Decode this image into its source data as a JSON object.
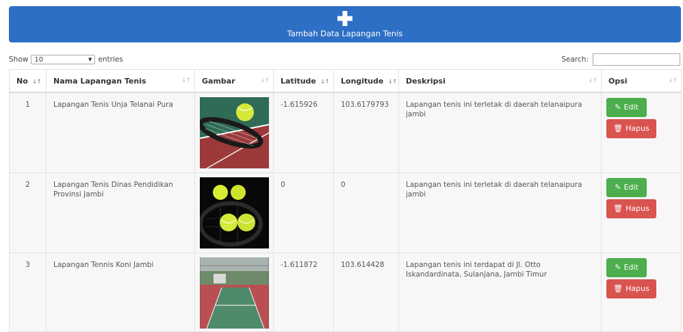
{
  "add_button": {
    "label": "Tambah Data Lapangan Tenis",
    "icon": "plus-icon"
  },
  "length_control": {
    "show_label": "Show",
    "value": "10",
    "entries_label": "entries"
  },
  "search": {
    "label": "Search:",
    "value": ""
  },
  "table": {
    "headers": [
      "No",
      "Nama Lapangan Tenis",
      "Gambar",
      "Latitude",
      "Longitude",
      "Deskripsi",
      "Opsi"
    ],
    "rows": [
      {
        "no": "1",
        "nama": "Lapangan Tenis Unja Telanai Pura",
        "gambar": "tennis-ball-racket-image",
        "latitude": "-1.615926",
        "longitude": "103.6179793",
        "deskripsi": "Lapangan tenis ini terletak di daerah telanaipura jambi"
      },
      {
        "no": "2",
        "nama": "Lapangan Tenis Dinas Pendidikan Provinsi Jambi",
        "gambar": "tennis-balls-image",
        "latitude": "0",
        "longitude": "0",
        "deskripsi": "Lapangan tenis ini terletak di daerah telanaipura jambi"
      },
      {
        "no": "3",
        "nama": "Lapangan Tennis Koni Jambi",
        "gambar": "tennis-court-image",
        "latitude": "-1.611872",
        "longitude": "103.614428",
        "deskripsi": "Lapangan tenis ini terdapat di Jl. Otto Iskandardinata, Sulanjana, Jambi Timur"
      }
    ]
  },
  "actions": {
    "edit_label": "Edit",
    "delete_label": "Hapus"
  },
  "colors": {
    "primary": "#2d6fc5",
    "edit": "#4cae4c",
    "delete": "#d9534f"
  }
}
